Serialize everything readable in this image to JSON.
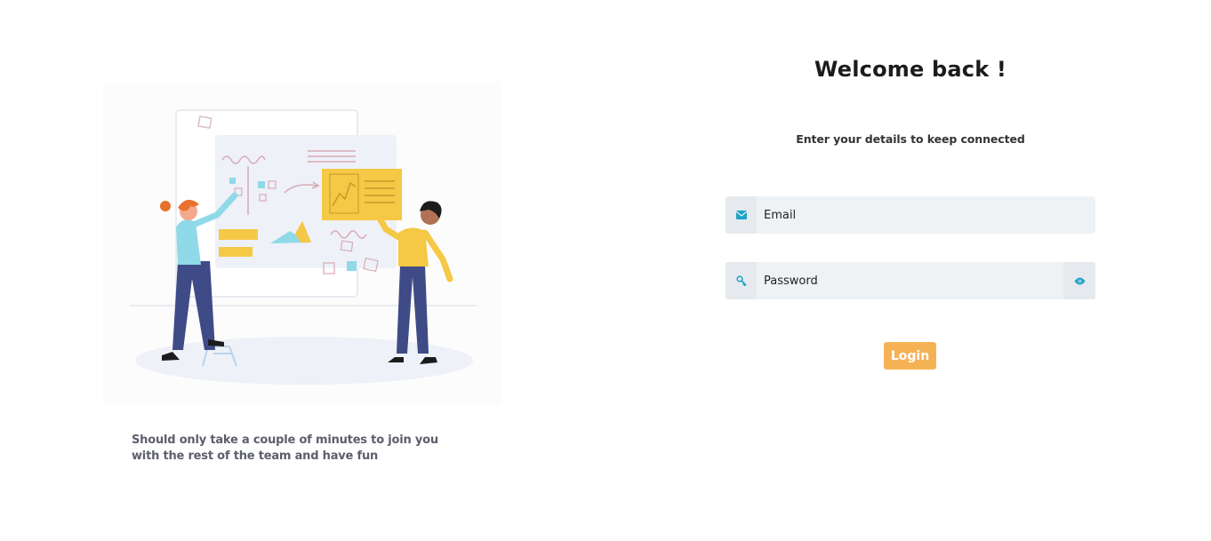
{
  "login": {
    "title": "Welcome back !",
    "subtitle": "Enter your details to keep connected",
    "email": {
      "placeholder": "Email",
      "value": "",
      "icon": "envelope-icon"
    },
    "password": {
      "placeholder": "Password",
      "value": "",
      "icon": "key-icon",
      "toggle_icon": "eye-icon"
    },
    "login_button_label": "Login"
  },
  "promo": {
    "tagline": "Should only take a couple of minutes to join you with the rest of the team and have fun"
  },
  "colors": {
    "accent": "#f5b255",
    "icon": "#1fa3c7",
    "field_bg": "#eff2f5"
  }
}
